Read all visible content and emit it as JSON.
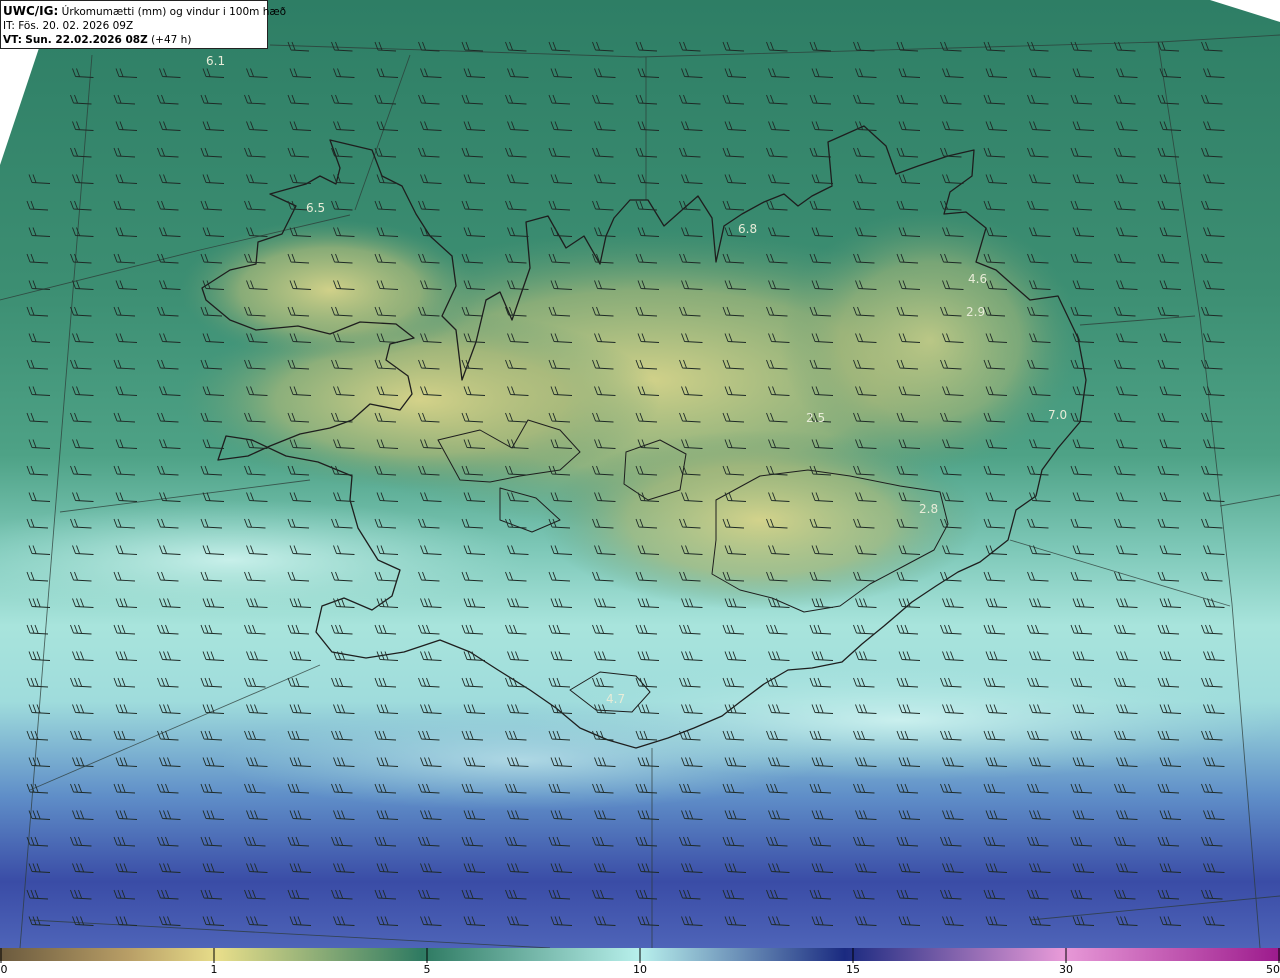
{
  "header": {
    "model": "UWC/IG:",
    "title": "Úrkomumætti (mm) og vindur i 100m hæð",
    "it_label": "IT:",
    "it_value": "Fös. 20. 02. 2026 09Z",
    "vt_label": "VT:",
    "vt_value": "Sun. 22.02.2026 08Z",
    "vt_lead": "(+47 h)"
  },
  "map_values": [
    "6.1",
    "6.5",
    "6.8",
    "4.6",
    "2.9",
    "2.5",
    "7.0",
    "2.8",
    "4.7"
  ],
  "colorbar": {
    "ticks": [
      "0",
      "1",
      "5",
      "10",
      "15",
      "30",
      "50"
    ],
    "colors": [
      "#6b5a3e",
      "#c4a86c",
      "#e8de8a",
      "#2e7a62",
      "#b8f0ec",
      "#1a2a80",
      "#e89ad8",
      "#9c1a8c"
    ]
  }
}
